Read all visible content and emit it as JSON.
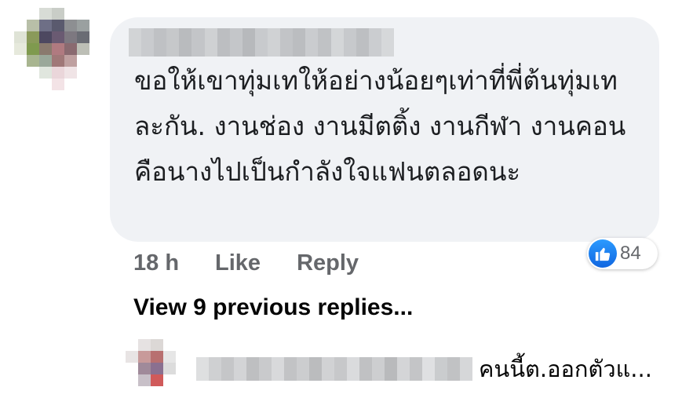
{
  "comment": {
    "text": "ขอให้เขาทุ่มเทให้อย่างน้อยๆเท่าที่พี่ต้นทุ่มเทละกัน. งานช่อง งานมีตติ้ง งานกีฬา งานคอน คือนางไปเป็นกำลังใจแฟนตลอดนะ",
    "time": "18 h",
    "like_label": "Like",
    "reply_label": "Reply",
    "reaction_icon": "like-icon",
    "reaction_count": "84"
  },
  "view_replies_label": "View 9 previous replies...",
  "reply_preview": {
    "text": "คนนี้ต.ออกตัวแ..."
  },
  "colors": {
    "bubble": "#f0f2f5",
    "secondary_text": "#65676b",
    "like_blue": "#1877f2"
  }
}
